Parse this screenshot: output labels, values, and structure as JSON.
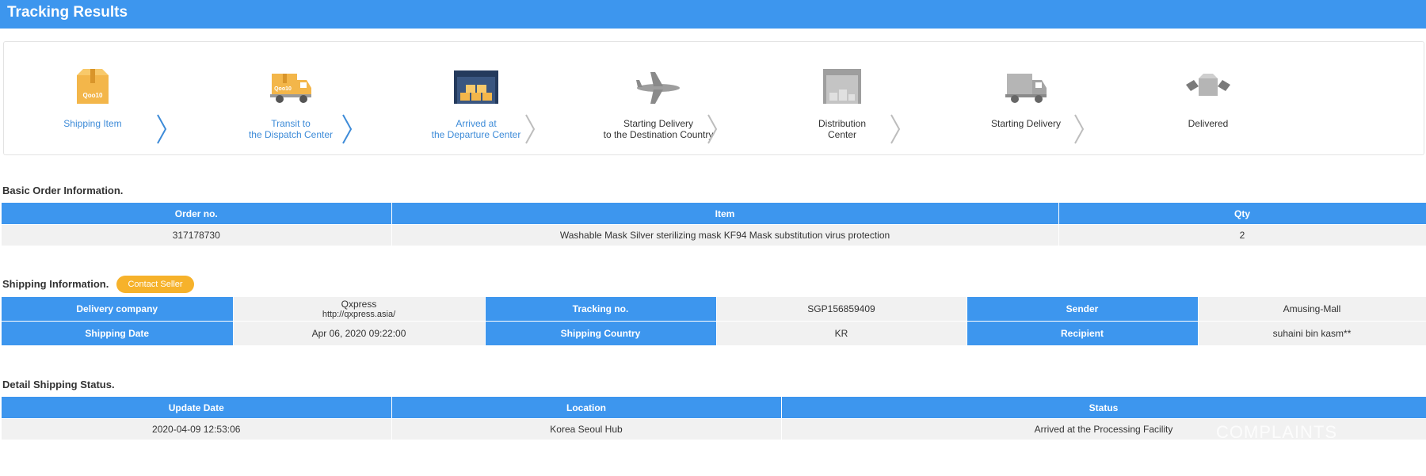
{
  "header": {
    "title": "Tracking Results"
  },
  "steps": [
    {
      "label_line1": "Shipping Item",
      "label_line2": "",
      "state": "done",
      "icon": "box-icon"
    },
    {
      "label_line1": "Transit to",
      "label_line2": "the Dispatch Center",
      "state": "done",
      "icon": "truck-icon"
    },
    {
      "label_line1": "Arrived at",
      "label_line2": "the Departure Center",
      "state": "done",
      "icon": "warehouse-icon"
    },
    {
      "label_line1": "Starting Delivery",
      "label_line2": "to the Destination Country",
      "state": "todo",
      "icon": "airplane-icon"
    },
    {
      "label_line1": "Distribution",
      "label_line2": "Center",
      "state": "todo",
      "icon": "distribution-center-icon"
    },
    {
      "label_line1": "Starting Delivery",
      "label_line2": "",
      "state": "todo",
      "icon": "delivery-truck-icon"
    },
    {
      "label_line1": "Delivered",
      "label_line2": "",
      "state": "todo",
      "icon": "delivered-icon"
    }
  ],
  "box_logo_text": "Qoo10",
  "colors": {
    "primary": "#3d96ee",
    "accent": "#f6b22b",
    "done_text": "#3d8bd8",
    "cell_bg": "#f1f1f1"
  },
  "basic_order": {
    "title": "Basic Order Information.",
    "headers": {
      "order_no": "Order no.",
      "item": "Item",
      "qty": "Qty"
    },
    "row": {
      "order_no": "317178730",
      "item": "Washable Mask Silver sterilizing mask KF94 Mask substitution virus protection",
      "qty": "2"
    }
  },
  "shipping_info": {
    "title": "Shipping Information.",
    "contact_button": "Contact Seller",
    "labels": {
      "delivery_company": "Delivery company",
      "tracking_no": "Tracking no.",
      "sender": "Sender",
      "shipping_date": "Shipping Date",
      "shipping_country": "Shipping Country",
      "recipient": "Recipient"
    },
    "values": {
      "delivery_company": "Qxpress",
      "delivery_company_url": "http://qxpress.asia/",
      "tracking_no": "SGP156859409",
      "sender": "Amusing-Mall",
      "shipping_date": "Apr 06, 2020 09:22:00",
      "shipping_country": "KR",
      "recipient": "suhaini bin kasm**"
    }
  },
  "detail_status": {
    "title": "Detail Shipping Status.",
    "headers": {
      "update_date": "Update Date",
      "location": "Location",
      "status": "Status"
    },
    "rows": [
      {
        "update_date": "2020-04-09 12:53:06",
        "location": "Korea Seoul Hub",
        "status": "Arrived at the Processing Facility"
      }
    ]
  },
  "watermark": "COMPLAINTS"
}
